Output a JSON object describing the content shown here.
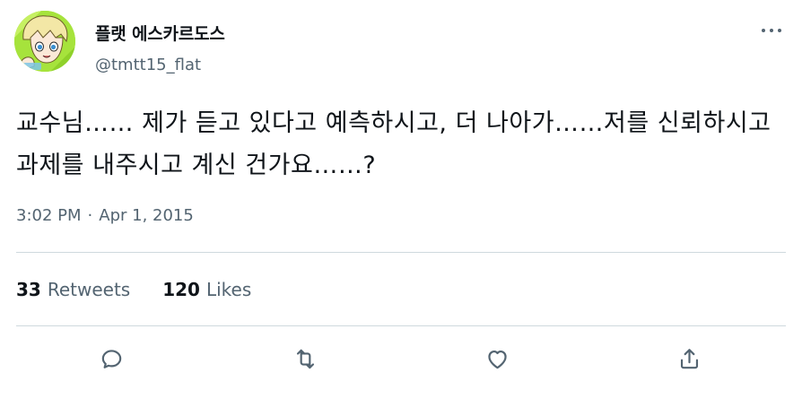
{
  "author": {
    "display_name": "플랫 에스카르도스",
    "handle": "@tmtt15_flat"
  },
  "tweet": {
    "text": "교수님…… 제가 듣고 있다고 예측하시고, 더 나아가……저를 신뢰하시고 과제를 내주시고 계신 건가요……?",
    "time": "3:02 PM",
    "separator": "·",
    "date": "Apr 1, 2015"
  },
  "stats": {
    "retweets_count": "33",
    "retweets_label": "Retweets",
    "likes_count": "120",
    "likes_label": "Likes"
  },
  "icons": {
    "more": "more-horizontal-icon",
    "reply": "reply-icon",
    "retweet": "retweet-icon",
    "like": "heart-icon",
    "share": "share-icon"
  },
  "colors": {
    "text_primary": "#0f1419",
    "text_secondary": "#536471",
    "divider": "#cfd9de",
    "avatar_bg": "#9ee03a"
  }
}
